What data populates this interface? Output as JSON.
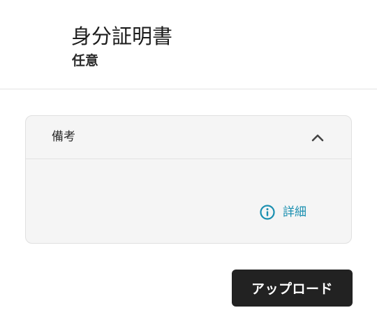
{
  "header": {
    "title": "身分証明書",
    "subtitle": "任意"
  },
  "panel": {
    "title": "備考",
    "collapse_icon": "chevron-up-icon",
    "details_link": {
      "label": "詳細",
      "icon": "info-icon"
    }
  },
  "actions": {
    "upload_label": "アップロード"
  },
  "colors": {
    "accent": "#1a8fb0",
    "button_bg": "#222222",
    "panel_bg": "#f5f5f5"
  }
}
